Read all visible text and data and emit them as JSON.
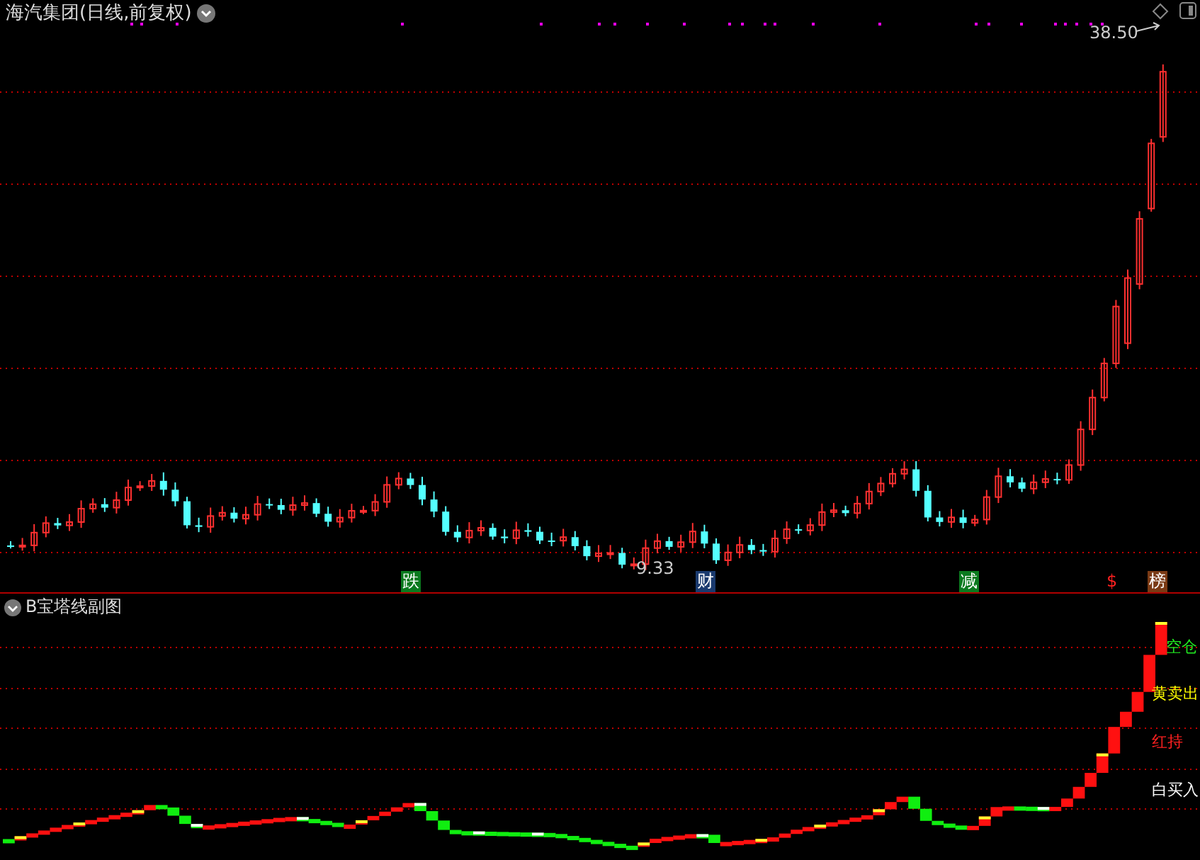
{
  "main_chart": {
    "title": "海汽集团(日线,前复权)",
    "high_label": "38.50",
    "low_label": "9.33",
    "badges": [
      {
        "text": "跌",
        "color": "#0a7a1e"
      },
      {
        "text": "财",
        "color": "#1a3a6e"
      },
      {
        "text": "减",
        "color": "#0a7a1e"
      },
      {
        "text": "$",
        "color": "#000000"
      },
      {
        "text": "榜",
        "color": "#7a3a14"
      }
    ]
  },
  "sub_chart": {
    "title": "B宝塔线副图",
    "legend": [
      {
        "text": "空仓",
        "color": "#22ee22"
      },
      {
        "text": "黄卖出",
        "color": "#ffff00"
      },
      {
        "text": "红持",
        "color": "#ff2020"
      },
      {
        "text": "白买入",
        "color": "#ffffff"
      }
    ]
  }
}
